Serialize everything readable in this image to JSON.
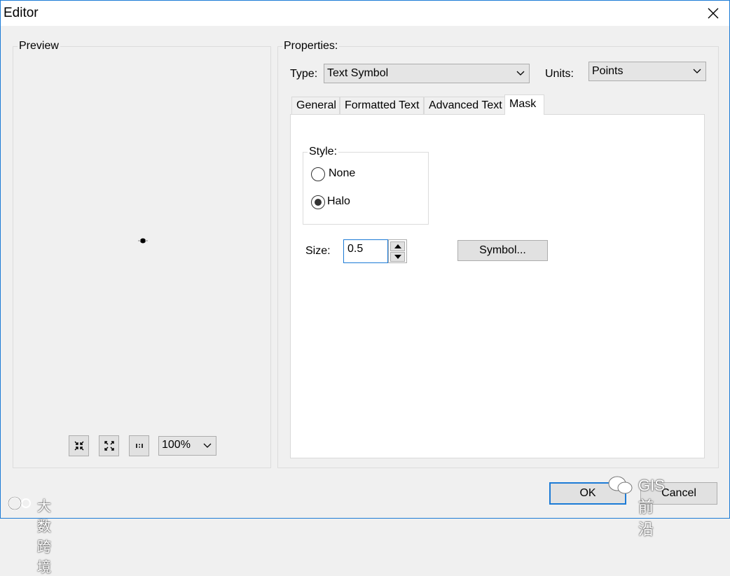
{
  "window": {
    "title": "Editor"
  },
  "preview": {
    "label": "Preview",
    "zoom": {
      "value": "100%"
    },
    "tools": [
      "zoom-to-fit-icon",
      "full-extent-icon",
      "actual-size-icon"
    ]
  },
  "properties": {
    "label": "Properties:",
    "type_label": "Type:",
    "type_value": "Text Symbol",
    "units_label": "Units:",
    "units_value": "Points",
    "tabs": [
      {
        "label": "General"
      },
      {
        "label": "Formatted Text"
      },
      {
        "label": "Advanced Text"
      },
      {
        "label": "Mask",
        "active": true
      }
    ],
    "mask": {
      "style_label": "Style:",
      "options": [
        {
          "label": "None",
          "selected": false
        },
        {
          "label": "Halo",
          "selected": true
        }
      ],
      "size_label": "Size:",
      "size_value": "0.5",
      "symbol_button": "Symbol..."
    }
  },
  "footer": {
    "ok": "OK",
    "cancel": "Cancel"
  },
  "watermarks": {
    "left": "大数跨境",
    "right": "GIS前沿"
  }
}
